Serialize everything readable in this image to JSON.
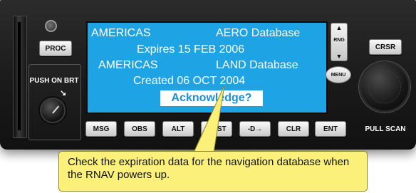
{
  "screen": {
    "line1_left": "AMERICAS",
    "line1_right": "AERO Database",
    "line2": "Expires 15 FEB 2006",
    "line3_left": "AMERICAS",
    "line3_right": "LAND Database",
    "line4": "Created  06 OCT 2004",
    "acknowledge": "Acknowledge?"
  },
  "buttons": {
    "proc": "PROC",
    "crsr": "CRSR",
    "msg": "MSG",
    "obs": "OBS",
    "alt": "ALT",
    "nrst": "NRST",
    "direct_to": "-D→",
    "clr": "CLR",
    "ent": "ENT",
    "menu": "MENU",
    "rng": "RNG",
    "rng_up": "▲",
    "rng_down": "▼"
  },
  "knobs": {
    "brightness_label": "PUSH ON BRT",
    "brightness_arrow": "↘",
    "pull_scan_label": "PULL SCAN"
  },
  "callout": {
    "text": "Check the expiration data for the navigation database when the RNAV powers up."
  },
  "colors": {
    "screen_background": "#1ea3e4",
    "screen_text": "#ffffff",
    "bezel": "#1e1e1e",
    "callout_background": "#fbf07a"
  }
}
